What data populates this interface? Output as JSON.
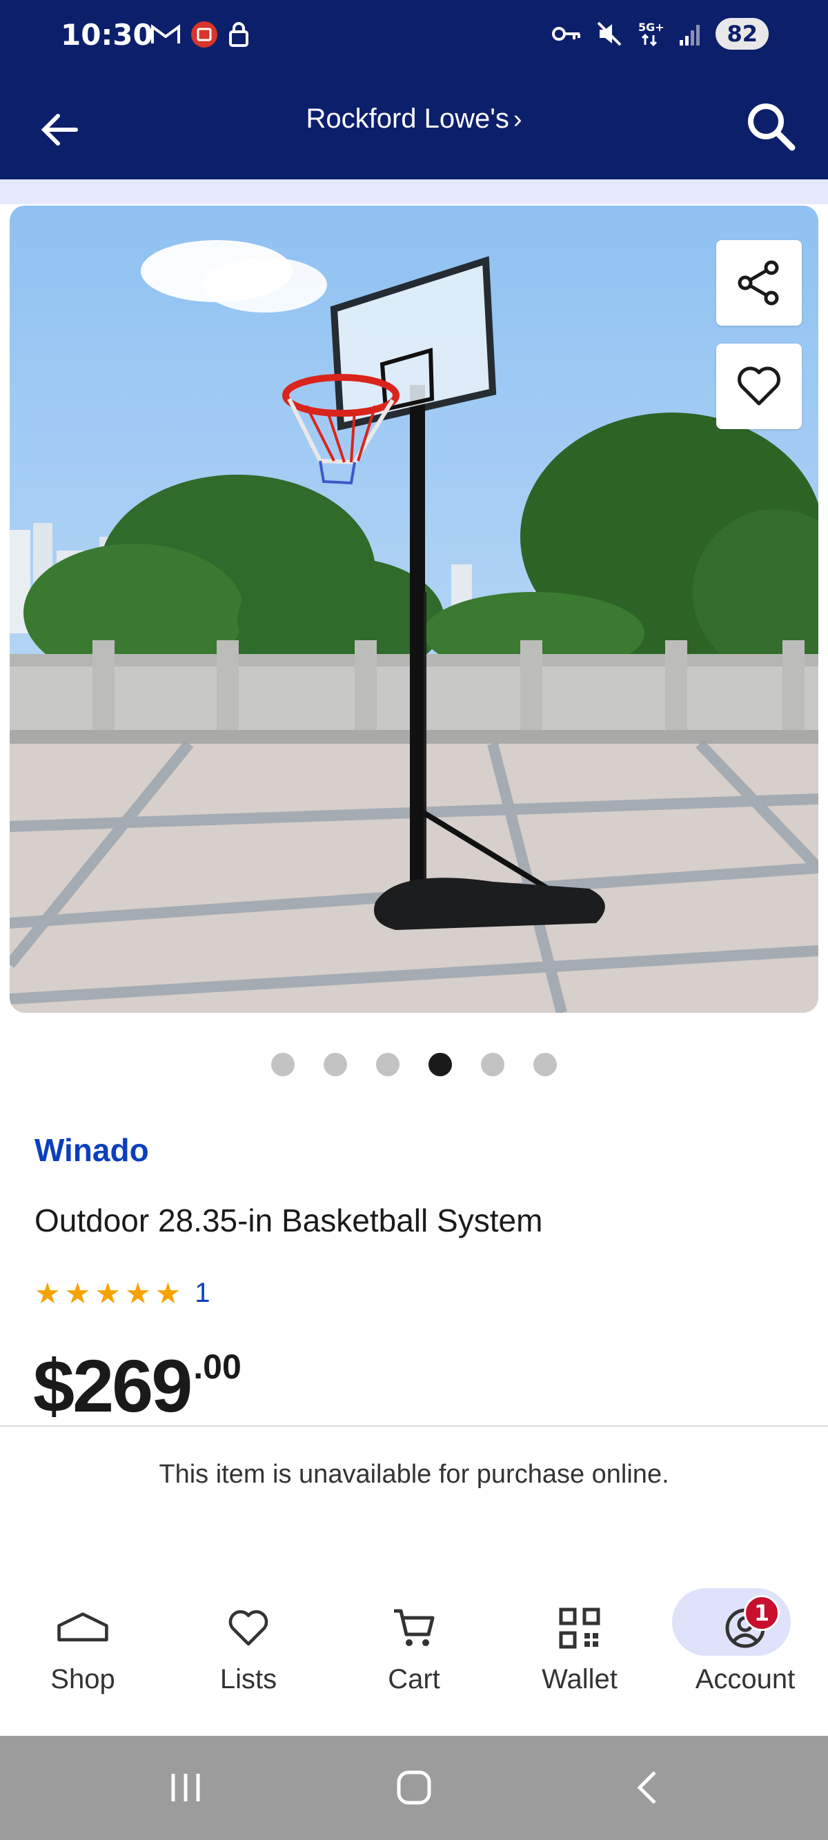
{
  "status": {
    "time": "10:30",
    "battery": "82"
  },
  "header": {
    "store_name": "Rockford Lowe's",
    "store_chevron": "›"
  },
  "product": {
    "brand": "Winado",
    "title": "Outdoor 28.35-in Basketball System",
    "rating_stars": 5,
    "rating_count": "1",
    "price_dollars": "$269",
    "price_cents": ".00",
    "availability": "This item is unavailable for purchase online."
  },
  "carousel": {
    "count": 6,
    "active_index": 3
  },
  "nav": {
    "shop": "Shop",
    "lists": "Lists",
    "cart": "Cart",
    "wallet": "Wallet",
    "account": "Account",
    "account_badge": "1"
  },
  "colors": {
    "header": "#0c1f6b",
    "brand": "#0a3fbd",
    "star": "#f5a300",
    "badge": "#c8102e"
  }
}
